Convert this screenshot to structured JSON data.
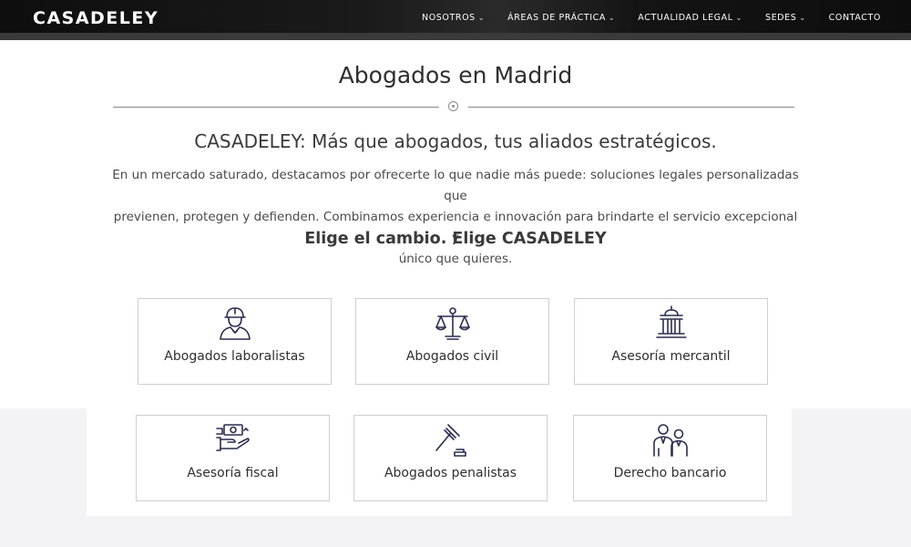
{
  "header": {
    "logo": "CASADELEY",
    "nav": [
      {
        "label": "NOSOTROS",
        "has_dropdown": true
      },
      {
        "label": "ÁREAS DE PRÁCTICA",
        "has_dropdown": true
      },
      {
        "label": "ACTUALIDAD LEGAL",
        "has_dropdown": true
      },
      {
        "label": "SEDES",
        "has_dropdown": true
      },
      {
        "label": "CONTACTO",
        "has_dropdown": false
      }
    ],
    "chevron": "⌄"
  },
  "main": {
    "title": "Abogados en Madrid",
    "subtitle": "CASADELEY: Más que abogados, tus aliados estratégicos.",
    "intro_lines": [
      "En un mercado saturado, destacamos por ofrecerte lo que nadie más puede: soluciones legales personalizadas que",
      "previenen, protegen y defienden.  Combinamos experiencia e innovación para brindarte el servicio excepcional y",
      "único que quieres."
    ],
    "cta": "Elige el cambio.  Elige CASADELEY"
  },
  "cards": [
    {
      "label": "Abogados laboralistas",
      "icon": "worker-helmet-icon"
    },
    {
      "label": "Abogados civil",
      "icon": "scales-of-justice-icon"
    },
    {
      "label": "Asesoría mercantil",
      "icon": "courthouse-icon"
    },
    {
      "label": "Asesoría fiscal",
      "icon": "money-hand-icon"
    },
    {
      "label": "Abogados penalistas",
      "icon": "gavel-icon"
    },
    {
      "label": "Derecho bancario",
      "icon": "business-people-icon"
    }
  ],
  "colors": {
    "header_bg": "#111111",
    "icon_stroke": "#2b2d4f",
    "card_border": "#cfcfcf",
    "grey_band": "#f3f3f5"
  }
}
